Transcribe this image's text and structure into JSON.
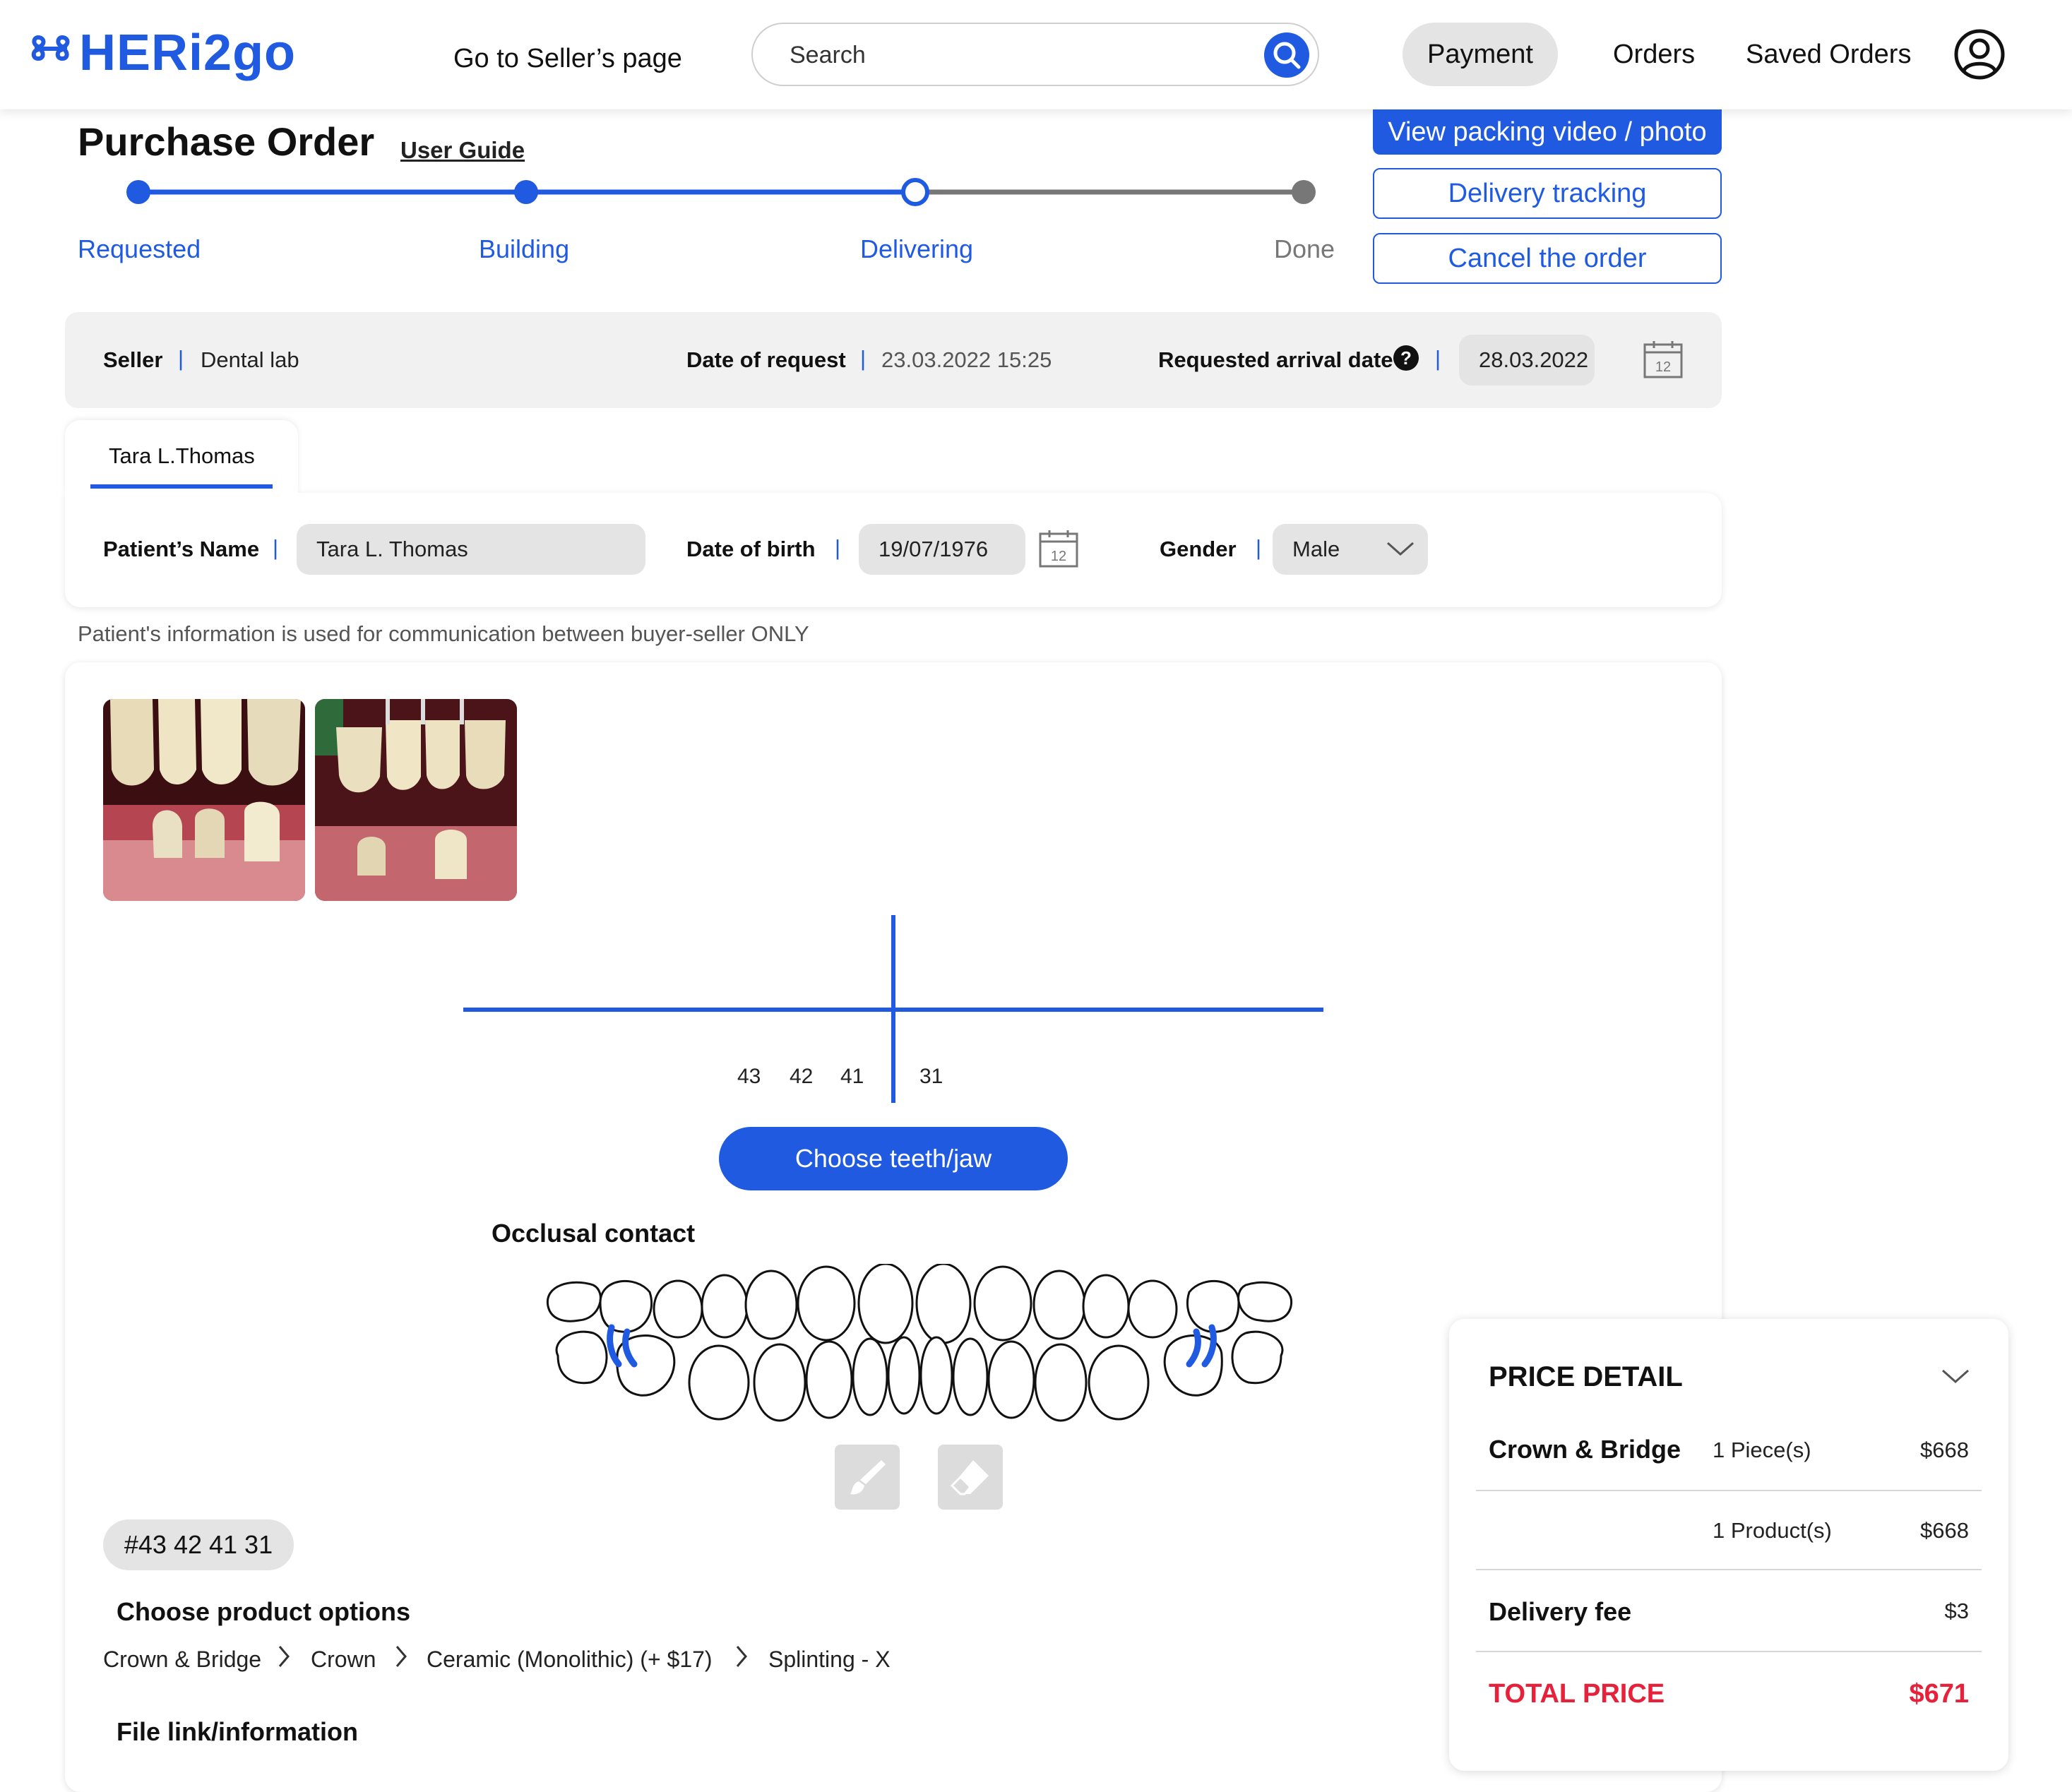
{
  "header": {
    "logo_text": "HERi2go",
    "seller_link": "Go to Seller’s page",
    "search_placeholder": "Search",
    "nav": {
      "payment": "Payment",
      "orders": "Orders",
      "saved_orders": "Saved Orders"
    }
  },
  "page": {
    "title": "Purchase Order",
    "user_guide": "User Guide",
    "actions": {
      "packing": "View packing video / photo",
      "tracking": "Delivery tracking",
      "cancel": "Cancel the order"
    }
  },
  "progress": {
    "steps": [
      "Requested",
      "Building",
      "Delivering",
      "Done"
    ],
    "current_step": "Delivering"
  },
  "order_info": {
    "seller_label": "Seller",
    "seller_value": "Dental lab",
    "date_request_label": "Date of request",
    "date_request_value": "23.03.2022 15:25",
    "arrival_label": "Requested arrival date",
    "arrival_value": "28.03.2022",
    "calendar_day": "12"
  },
  "patient": {
    "tab_label": "Tara L.Thomas",
    "name_label": "Patient’s Name",
    "name_value": "Tara L. Thomas",
    "dob_label": "Date  of birth",
    "dob_value": "19/07/1976",
    "gender_label": "Gender",
    "gender_value": "Male",
    "note": "Patient's information is used for communication between buyer-seller ONLY"
  },
  "teeth": {
    "numbers_left": [
      "43",
      "42",
      "41"
    ],
    "numbers_right": [
      "31"
    ],
    "choose_button": "Choose teeth/jaw",
    "occlusal_title": "Occlusal contact",
    "selected_tag": "#43 42 41 31"
  },
  "product_options": {
    "title": "Choose product options",
    "breadcrumb": [
      "Crown & Bridge",
      "Crown",
      "Ceramic (Monolithic) (+ $17)",
      "Splinting - X"
    ]
  },
  "file_section": {
    "title": "File link/information"
  },
  "price_detail": {
    "title": "PRICE DETAIL",
    "item_name": "Crown & Bridge",
    "item_qty": "1 Piece(s)",
    "item_price": "$668",
    "products_qty": "1 Product(s)",
    "products_price": "$668",
    "delivery_label": "Delivery fee",
    "delivery_price": "$3",
    "total_label": "TOTAL PRICE",
    "total_price": "$671"
  },
  "colors": {
    "primary": "#1f5ae0",
    "total_red": "#e8213a",
    "panel_gray": "#f1f1f1"
  }
}
